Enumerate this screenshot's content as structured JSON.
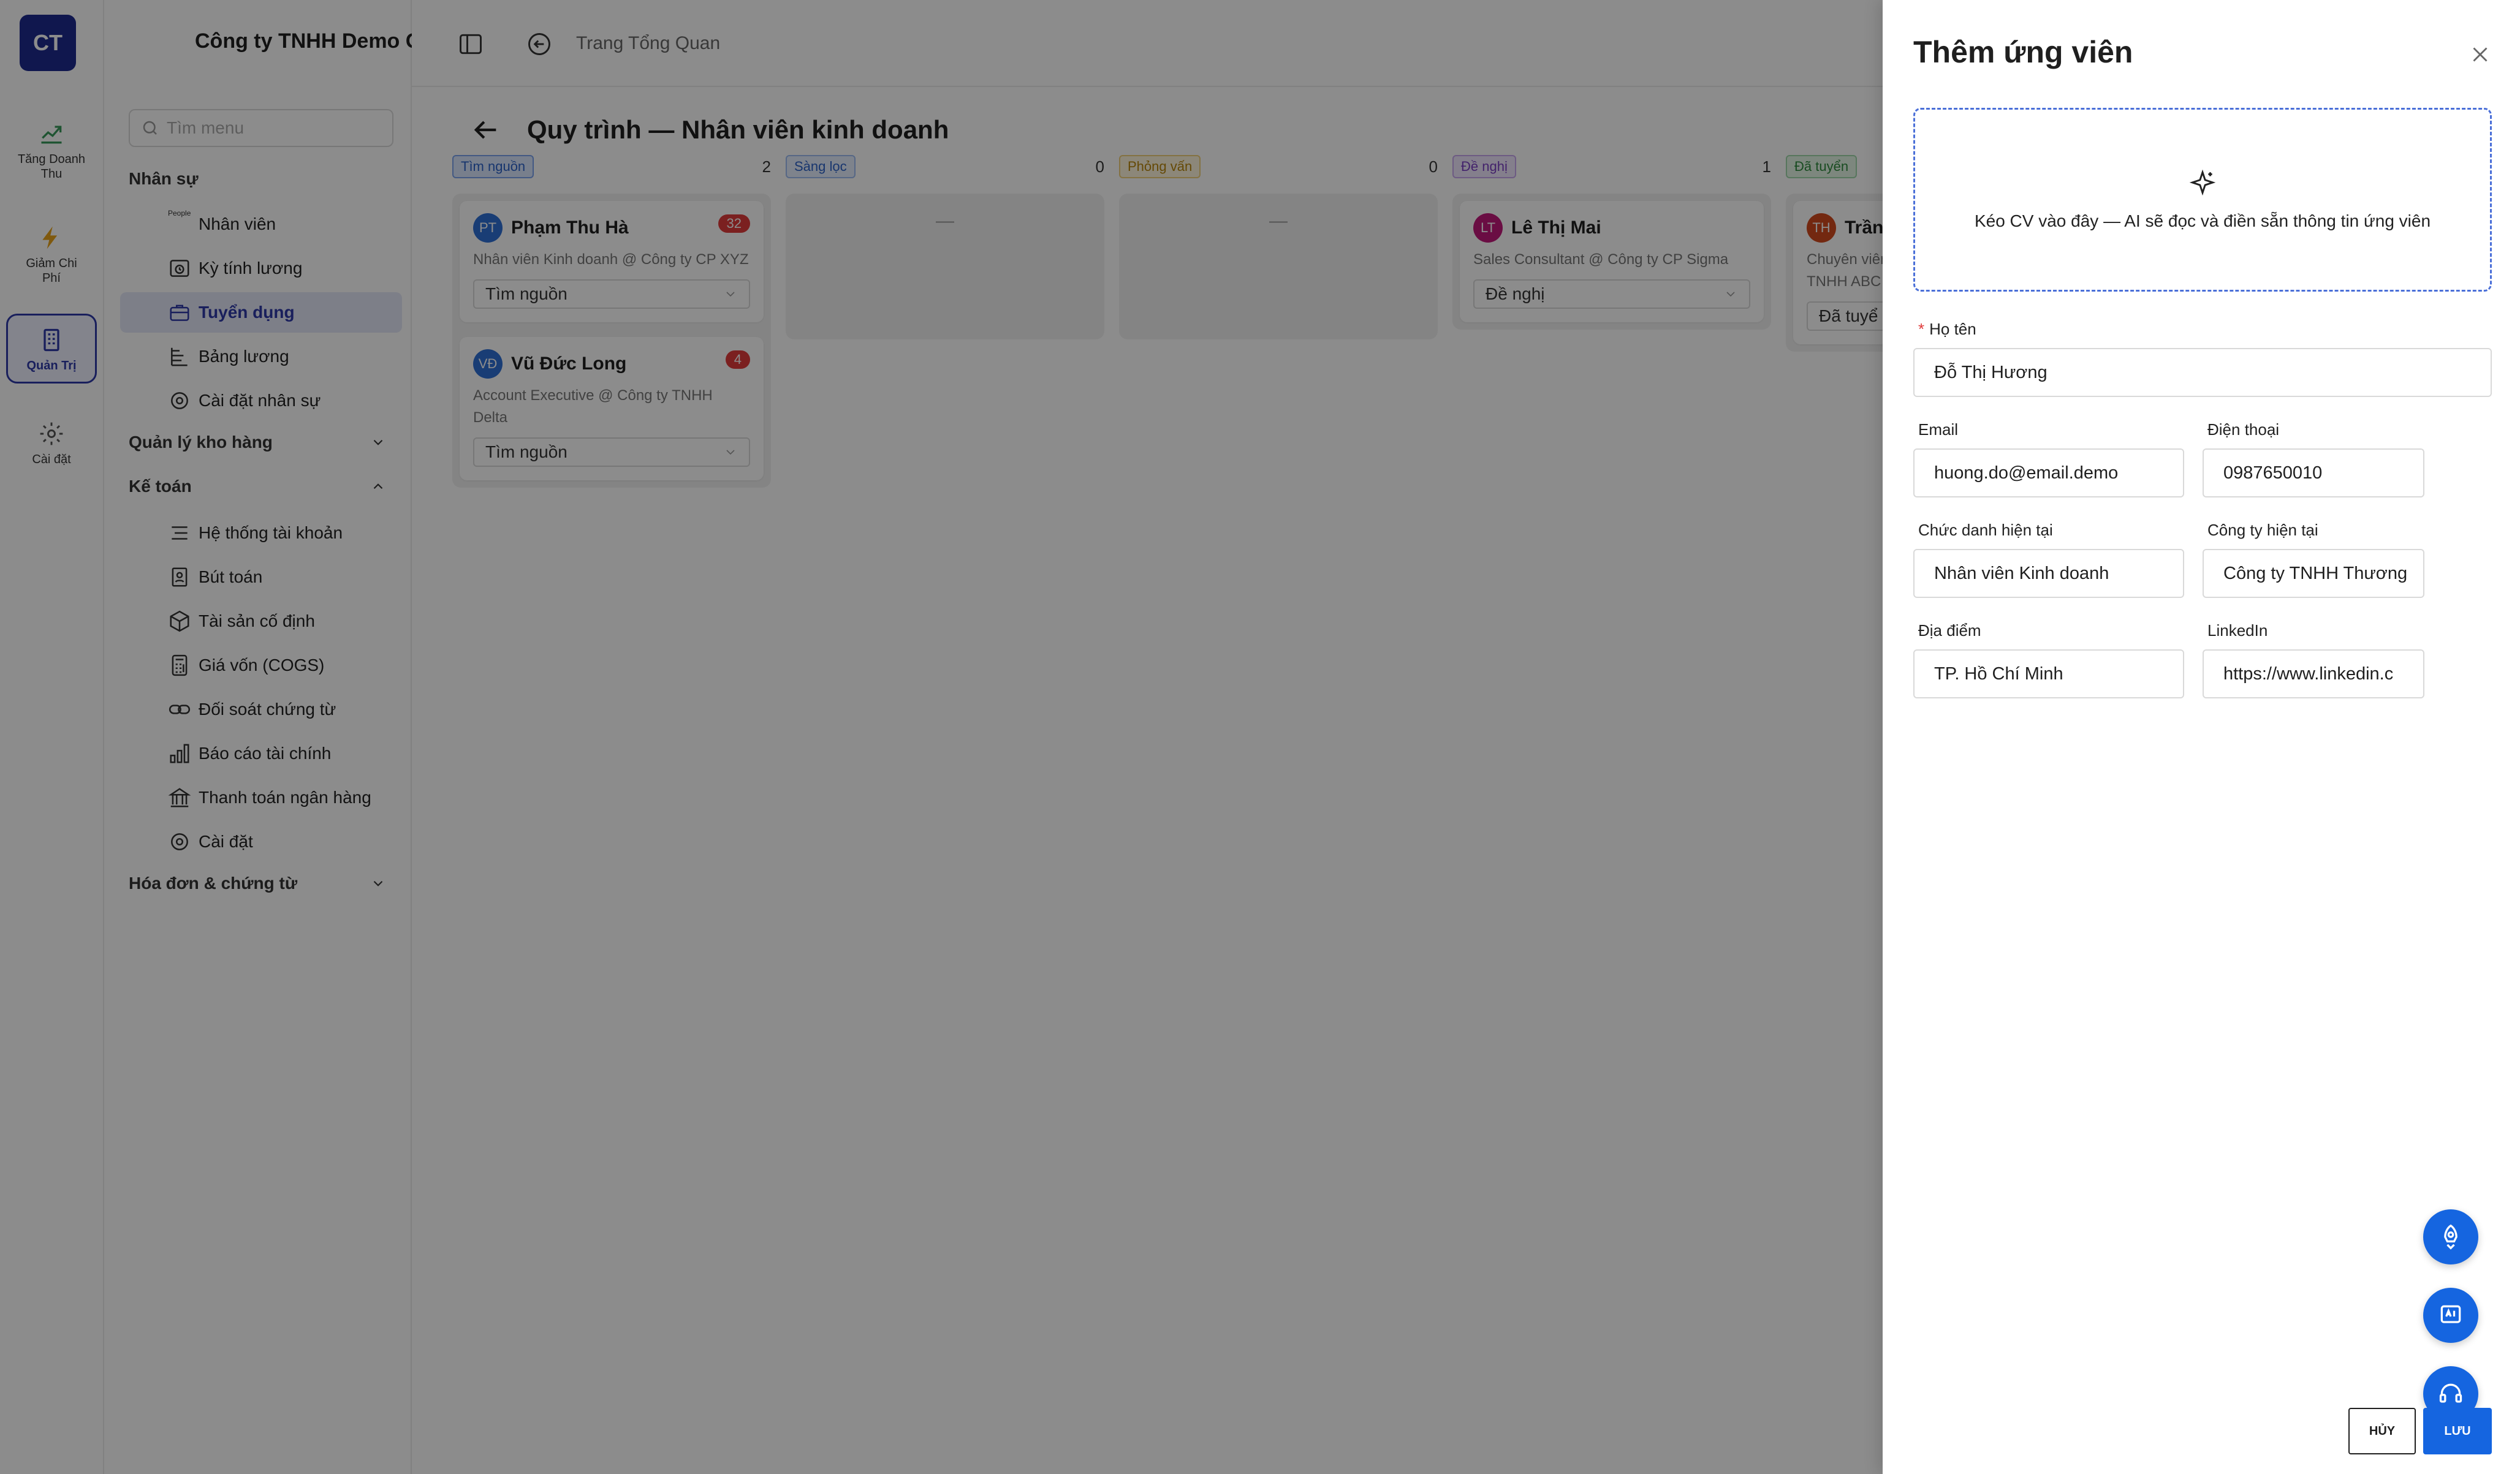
{
  "app": {
    "logo_initials": "CT",
    "company_name": "Công ty TNHH Demo GTG"
  },
  "rail": [
    {
      "label": "Tăng Doanh\nThu",
      "icon": "trend-up-icon"
    },
    {
      "label": "Giảm Chi\nPhí",
      "icon": "lightning-icon"
    },
    {
      "label": "Quản Trị",
      "icon": "building-icon",
      "active": true
    },
    {
      "label": "Cài đặt",
      "icon": "gear-icon"
    }
  ],
  "menu": {
    "search_placeholder": "Tìm menu",
    "groups": [
      {
        "label": "Nhân sự"
      },
      {
        "label": "Quản lý kho hàng"
      },
      {
        "label": "Kế toán"
      },
      {
        "label": "Hóa đơn & chứng từ"
      }
    ],
    "hr_items": [
      {
        "label": "Nhân viên",
        "icon_text": "People"
      },
      {
        "label": "Kỳ tính lương"
      },
      {
        "label": "Tuyển dụng",
        "active": true
      },
      {
        "label": "Bảng lương"
      },
      {
        "label": "Cài đặt nhân sự"
      }
    ],
    "acct_items": [
      {
        "label": "Hệ thống tài khoản"
      },
      {
        "label": "Bút toán"
      },
      {
        "label": "Tài sản cố định"
      },
      {
        "label": "Giá vốn (COGS)"
      },
      {
        "label": "Đối soát chứng từ"
      },
      {
        "label": "Báo cáo tài chính"
      },
      {
        "label": "Thanh toán ngân hàng"
      },
      {
        "label": "Cài đặt"
      }
    ]
  },
  "topbar": {
    "breadcrumb": "Trang Tổng Quan"
  },
  "pipeline": {
    "title": "Quy trình — Nhân viên kinh doanh",
    "empty_marker": "—",
    "columns": [
      {
        "stage": "Tìm nguồn",
        "count": "2",
        "color": "#2b62c9",
        "bg": "#dbe7ff",
        "cards": [
          {
            "initials": "VĐ",
            "avatar_color": "#2f6fd6",
            "name": "Vũ Đức Long",
            "score": "4",
            "subtitle": "Account Executive @ Công ty TNHH Delta",
            "stage_value": "Tìm nguồn",
            "order": 2
          },
          {
            "initials": "PT",
            "avatar_color": "#2f6fd6",
            "name": "Phạm Thu Hà",
            "score": "32",
            "subtitle": "Nhân viên Kinh doanh @ Công ty CP XYZ",
            "stage_value": "Tìm nguồn",
            "order": 1
          }
        ]
      },
      {
        "stage": "Sàng lọc",
        "count": "0",
        "color": "#2b62c9",
        "bg": "#e6efff",
        "cards": []
      },
      {
        "stage": "Phỏng vấn",
        "count": "0",
        "color": "#b8860b",
        "bg": "#fff6dc",
        "cards": []
      },
      {
        "stage": "Đề nghị",
        "count": "1",
        "color": "#7b3fc4",
        "bg": "#f1e8ff",
        "cards": [
          {
            "initials": "LT",
            "avatar_color": "#c2187a",
            "name": "Lê Thị Mai",
            "score": "",
            "subtitle": "Sales Consultant @ Công ty CP Sigma",
            "stage_value": "Đề nghị"
          }
        ]
      },
      {
        "stage": "Đã tuyển",
        "count": "",
        "color": "#2e8b3d",
        "bg": "#e3f6e6",
        "cards": [
          {
            "initials": "TH",
            "avatar_color": "#d24a1e",
            "name": "Trần",
            "score": "",
            "subtitle": "Chuyên viên\nTNHH ABC",
            "stage_value": "Đã tuyể"
          }
        ]
      }
    ]
  },
  "drawer": {
    "title": "Thêm ứng viên",
    "dropzone_text": "Kéo CV vào đây — AI sẽ đọc và điền sẵn thông tin ứng viên",
    "fields": {
      "full_name": {
        "label": "Họ tên",
        "value": "Đỗ Thị Hương",
        "required": "*"
      },
      "email": {
        "label": "Email",
        "value": "huong.do@email.demo"
      },
      "phone": {
        "label": "Điện thoại",
        "value": "0987650010"
      },
      "title": {
        "label": "Chức danh hiện tại",
        "value": "Nhân viên Kinh doanh"
      },
      "company": {
        "label": "Công ty hiện tại",
        "value": "Công ty TNHH Thương"
      },
      "location": {
        "label": "Địa điểm",
        "value": "TP. Hồ Chí Minh"
      },
      "linkedin": {
        "label": "LinkedIn",
        "value": "https://www.linkedin.c"
      }
    },
    "cancel_label": "HỦY",
    "save_label": "LƯU"
  },
  "colors": {
    "brand": "#1e2b8f",
    "primary": "#1565e0",
    "danger": "#e03b3b"
  }
}
